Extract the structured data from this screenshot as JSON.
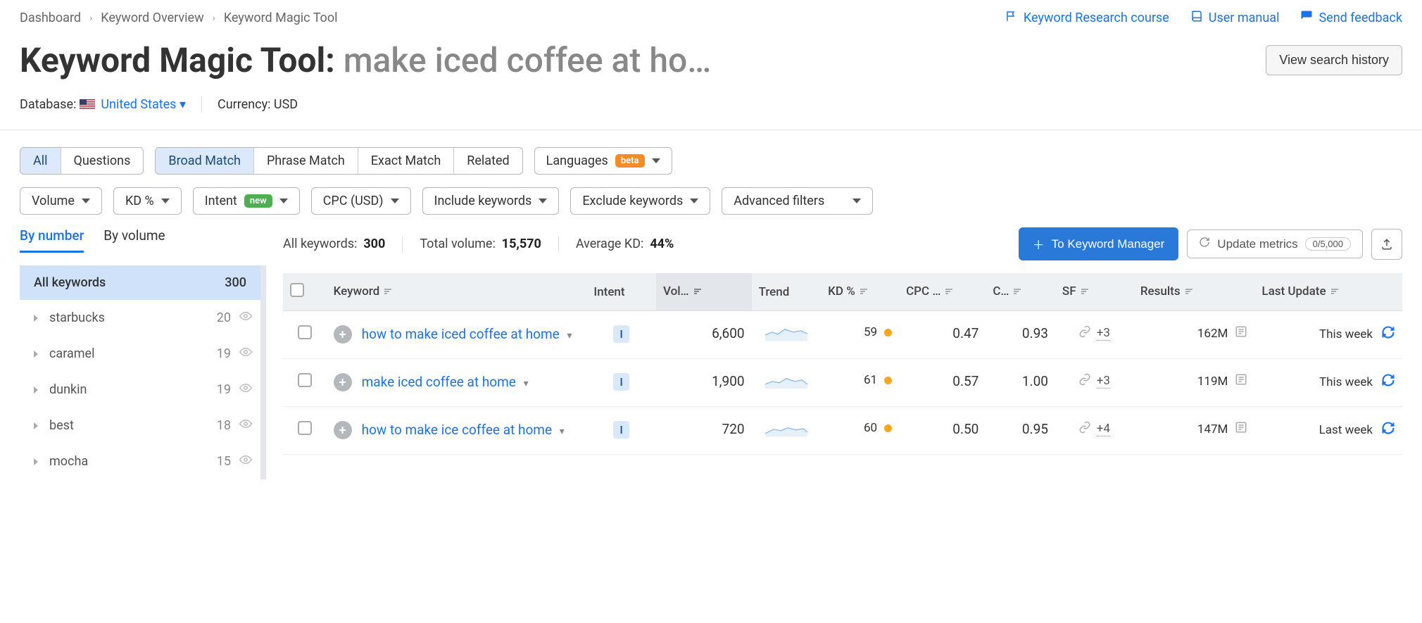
{
  "breadcrumb": [
    "Dashboard",
    "Keyword Overview",
    "Keyword Magic Tool"
  ],
  "top_links": {
    "research_course": "Keyword Research course",
    "user_manual": "User manual",
    "send_feedback": "Send feedback"
  },
  "title": {
    "tool": "Keyword Magic Tool:",
    "query": "make iced coffee at ho…"
  },
  "buttons": {
    "view_history": "View search history",
    "to_manager": "To Keyword Manager",
    "update_metrics": "Update metrics",
    "quota": "0/5,000"
  },
  "meta": {
    "database_label": "Database:",
    "database_value": "United States",
    "currency_label": "Currency:",
    "currency_value": "USD"
  },
  "segments1": {
    "all": "All",
    "questions": "Questions",
    "broad": "Broad Match",
    "phrase": "Phrase Match",
    "exact": "Exact Match",
    "related": "Related"
  },
  "languages": {
    "label": "Languages",
    "badge": "beta"
  },
  "filters2": {
    "volume": "Volume",
    "kd": "KD %",
    "intent": "Intent",
    "intent_badge": "new",
    "cpc": "CPC (USD)",
    "include": "Include keywords",
    "exclude": "Exclude keywords",
    "advanced": "Advanced filters"
  },
  "side_tabs": {
    "by_number": "By number",
    "by_volume": "By volume"
  },
  "side_header": {
    "label": "All keywords",
    "count": "300"
  },
  "side_items": [
    {
      "name": "starbucks",
      "count": "20"
    },
    {
      "name": "caramel",
      "count": "19"
    },
    {
      "name": "dunkin",
      "count": "19"
    },
    {
      "name": "best",
      "count": "18"
    },
    {
      "name": "mocha",
      "count": "15"
    }
  ],
  "stats": {
    "all_label": "All keywords:",
    "all_value": "300",
    "vol_label": "Total volume:",
    "vol_value": "15,570",
    "kd_label": "Average KD:",
    "kd_value": "44%"
  },
  "columns": {
    "keyword": "Keyword",
    "intent": "Intent",
    "volume": "Vol…",
    "trend": "Trend",
    "kd": "KD %",
    "cpc": "CPC …",
    "com": "C…",
    "sf": "SF",
    "results": "Results",
    "last_update": "Last Update"
  },
  "rows": [
    {
      "keyword": "how to make iced coffee at home",
      "intent": "I",
      "volume": "6,600",
      "kd": "59",
      "cpc": "0.47",
      "com": "0.93",
      "sf": "+3",
      "results": "162M",
      "updated": "This week"
    },
    {
      "keyword": "make iced coffee at home",
      "intent": "I",
      "volume": "1,900",
      "kd": "61",
      "cpc": "0.57",
      "com": "1.00",
      "sf": "+3",
      "results": "119M",
      "updated": "This week"
    },
    {
      "keyword": "how to make ice coffee at home",
      "intent": "I",
      "volume": "720",
      "kd": "60",
      "cpc": "0.50",
      "com": "0.95",
      "sf": "+4",
      "results": "147M",
      "updated": "Last week"
    }
  ]
}
